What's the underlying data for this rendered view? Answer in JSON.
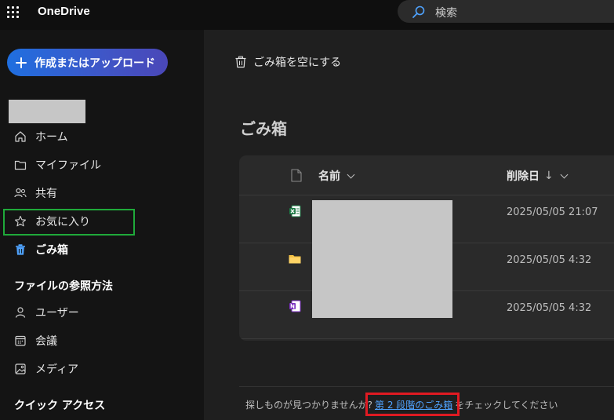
{
  "app": {
    "name": "OneDrive",
    "search_placeholder": "検索"
  },
  "sidebar": {
    "create_button_label": "作成またはアップロード",
    "nav": [
      {
        "label": "ホーム",
        "icon": "home-icon"
      },
      {
        "label": "マイファイル",
        "icon": "folder-icon"
      },
      {
        "label": "共有",
        "icon": "people-icon"
      },
      {
        "label": "お気に入り",
        "icon": "star-icon"
      },
      {
        "label": "ごみ箱",
        "icon": "trash-icon",
        "active": true
      }
    ],
    "browse_section_title": "ファイルの参照方法",
    "browse_items": [
      {
        "label": "ユーザー",
        "icon": "person-icon"
      },
      {
        "label": "会議",
        "icon": "calendar-icon"
      },
      {
        "label": "メディア",
        "icon": "image-icon"
      }
    ],
    "quick_access_title": "クイック アクセス"
  },
  "toolbar": {
    "empty_bin_label": "ごみ箱を空にする"
  },
  "page": {
    "title": "ごみ箱"
  },
  "list": {
    "columns": {
      "name": "名前",
      "deleted_date": "削除日",
      "sort_indicator": "↓"
    },
    "rows": [
      {
        "type_icon": "excel-icon",
        "deleted_date": "2025/05/05 21:07"
      },
      {
        "type_icon": "folder-icon",
        "deleted_date": "2025/05/05 4:32"
      },
      {
        "type_icon": "onenote-icon",
        "deleted_date": "2025/05/05 4:32"
      }
    ]
  },
  "footer": {
    "text_before": "探しものが見つかりませんか?",
    "link": "第 2 段階のごみ箱",
    "text_after": "をチェックしてください"
  },
  "colors": {
    "accent": "#4fa3ff",
    "highlight_green": "#1faa3a",
    "highlight_red": "#e01a22",
    "create_button": "#3f56c7"
  }
}
